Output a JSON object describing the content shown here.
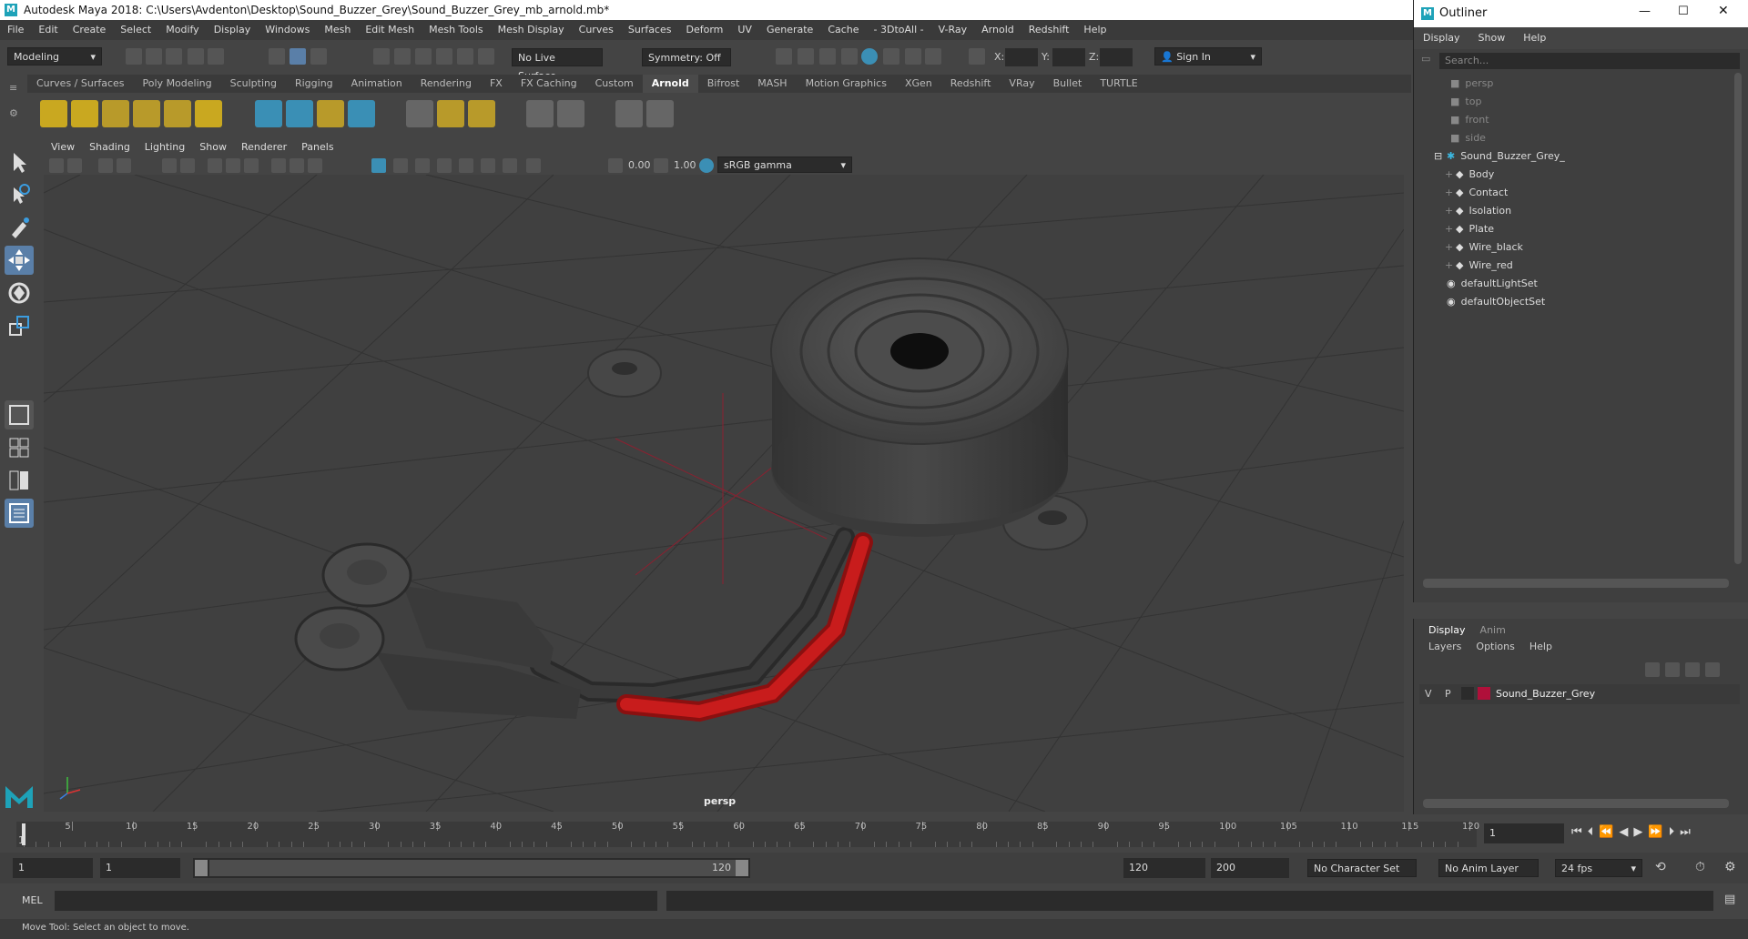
{
  "window": {
    "title": "Autodesk Maya 2018: C:\\Users\\Avdenton\\Desktop\\Sound_Buzzer_Grey\\Sound_Buzzer_Grey_mb_arnold.mb*"
  },
  "menubar": [
    "File",
    "Edit",
    "Create",
    "Select",
    "Modify",
    "Display",
    "Windows",
    "Mesh",
    "Edit Mesh",
    "Mesh Tools",
    "Mesh Display",
    "Curves",
    "Surfaces",
    "Deform",
    "UV",
    "Generate",
    "Cache",
    "- 3DtoAll -",
    "V-Ray",
    "Arnold",
    "Redshift",
    "Help"
  ],
  "statusline": {
    "mode": "Modeling",
    "live_surface": "No Live Surface",
    "symmetry": "Symmetry: Off",
    "x_label": "X:",
    "y_label": "Y:",
    "z_label": "Z:",
    "sign_in": "Sign In"
  },
  "shelf_tabs": [
    "Curves / Surfaces",
    "Poly Modeling",
    "Sculpting",
    "Rigging",
    "Animation",
    "Rendering",
    "FX",
    "FX Caching",
    "Custom",
    "Arnold",
    "Bifrost",
    "MASH",
    "Motion Graphics",
    "XGen",
    "Redshift",
    "VRay",
    "Bullet",
    "TURTLE"
  ],
  "active_shelf": "Arnold",
  "viewport": {
    "menu": [
      "View",
      "Shading",
      "Lighting",
      "Show",
      "Renderer",
      "Panels"
    ],
    "exposure": "0.00",
    "gamma": "1.00",
    "color_space": "sRGB gamma",
    "camera_label": "persp"
  },
  "outliner": {
    "title": "Outliner",
    "menu": [
      "Display",
      "Show",
      "Help"
    ],
    "search_placeholder": "Search...",
    "cameras": [
      "persp",
      "top",
      "front",
      "side"
    ],
    "group": "Sound_Buzzer_Grey_",
    "children": [
      "Body",
      "Contact",
      "Isolation",
      "Plate",
      "Wire_black",
      "Wire_red"
    ],
    "sets": [
      "defaultLightSet",
      "defaultObjectSet"
    ]
  },
  "layer_editor": {
    "tabs": [
      "Display",
      "Anim"
    ],
    "menu": [
      "Layers",
      "Options",
      "Help"
    ],
    "layer": {
      "v": "V",
      "p": "P",
      "name": "Sound_Buzzer_Grey",
      "color": "#b0103a"
    }
  },
  "timeline": {
    "ticks": [
      "5",
      "10",
      "15",
      "20",
      "25",
      "30",
      "35",
      "40",
      "45",
      "50",
      "55",
      "60",
      "65",
      "70",
      "75",
      "80",
      "85",
      "90",
      "95",
      "100",
      "105",
      "110",
      "115",
      "120"
    ],
    "first_tick": "1",
    "current_frame": "1"
  },
  "range": {
    "start": "1",
    "anim_start": "1",
    "slider_start": "1",
    "slider_end": "120",
    "end": "120",
    "anim_end": "200",
    "character_set": "No Character Set",
    "anim_layer": "No Anim Layer",
    "fps": "24 fps"
  },
  "cmdline": {
    "label": "MEL"
  },
  "helpline": {
    "text": "Move Tool: Select an object to move."
  }
}
